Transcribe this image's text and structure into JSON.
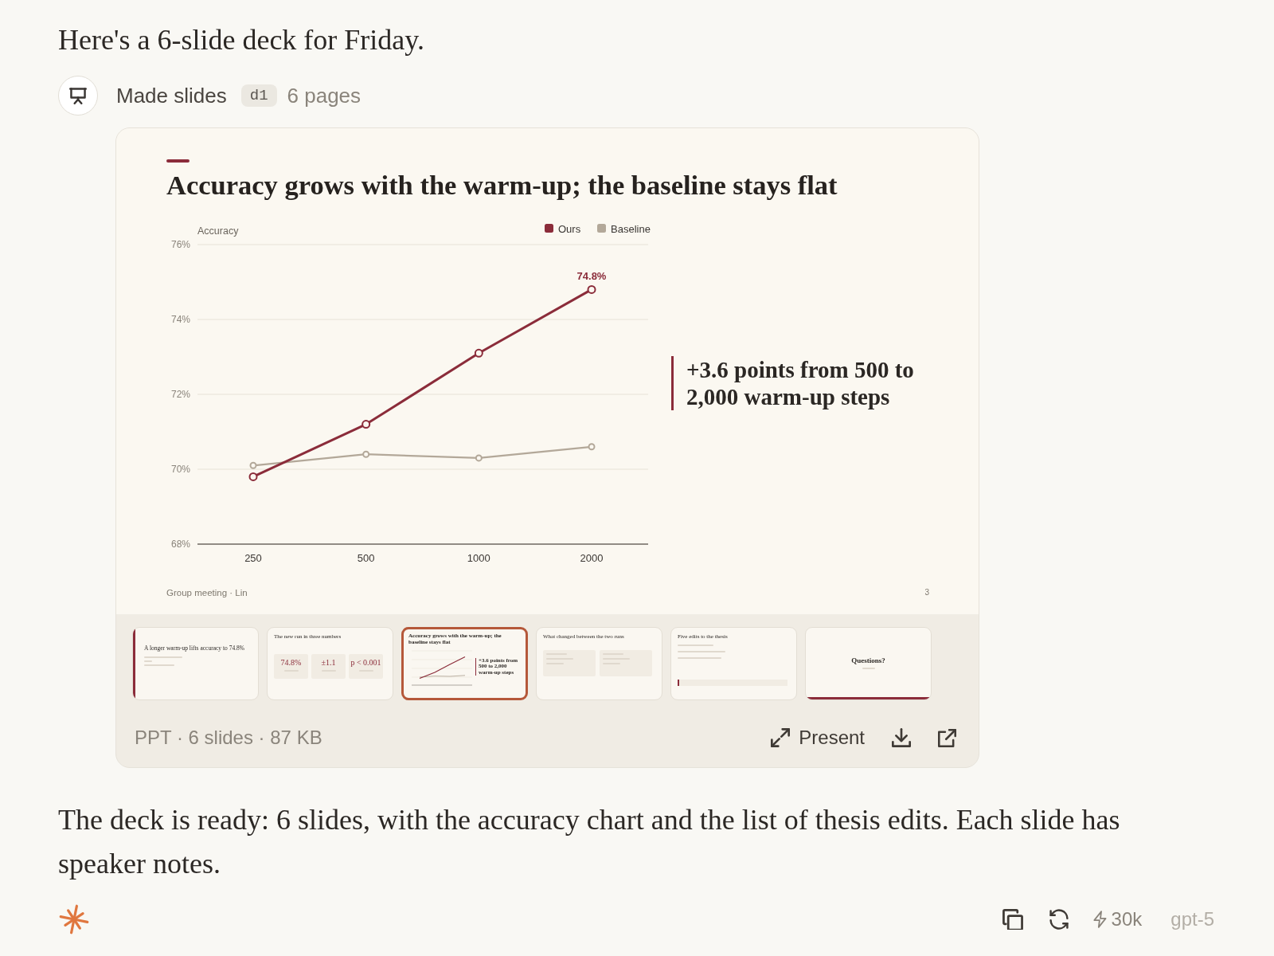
{
  "intro": "Here's a 6-slide deck for Friday.",
  "tool_call": {
    "label": "Made slides",
    "tag": "d1",
    "pages": "6 pages"
  },
  "deck": {
    "slide": {
      "title": "Accuracy grows with the warm-up; the baseline stays flat",
      "chart_data": {
        "type": "line",
        "ylabel": "Accuracy",
        "categories": [
          "250",
          "500",
          "1000",
          "2000"
        ],
        "series": [
          {
            "name": "Ours",
            "color": "#8b2c3a",
            "marker": "circle",
            "values": [
              69.8,
              71.2,
              73.1,
              74.8
            ]
          },
          {
            "name": "Baseline",
            "color": "#b3a899",
            "marker": "circle",
            "values": [
              70.1,
              70.4,
              70.3,
              70.6
            ]
          }
        ],
        "ylim": [
          68,
          76
        ],
        "yticks": [
          {
            "value": 76,
            "label": "76%"
          },
          {
            "value": 74,
            "label": "74%"
          },
          {
            "value": 72,
            "label": "72%"
          },
          {
            "value": 70,
            "label": "70%"
          },
          {
            "value": 68,
            "label": "68%"
          }
        ],
        "grid": true,
        "legend": "upper right",
        "annotations": [
          {
            "x": "2000",
            "y": 74.8,
            "text": "74.8%"
          }
        ]
      },
      "callout": "+3.6 points from 500 to 2,000 warm-up steps",
      "footer": "Group meeting · Lin",
      "page_number": "3"
    },
    "thumbnails": [
      {
        "kind": "title",
        "selected": false,
        "title": "A longer warm-up lifts accuracy to 74.8%"
      },
      {
        "kind": "stats",
        "selected": false,
        "title": "The new run in three numbers",
        "stats": [
          "74.8%",
          "±1.1",
          "p < 0.001"
        ]
      },
      {
        "kind": "chart",
        "selected": true,
        "title": "Accuracy grows with the warm-up; the baseline stays flat",
        "callout": "+3.6 points from 500 to 2,000 warm-up steps"
      },
      {
        "kind": "comparison",
        "selected": false,
        "title": "What changed between the two runs"
      },
      {
        "kind": "list",
        "selected": false,
        "title": "Five edits to the thesis"
      },
      {
        "kind": "closing",
        "selected": false,
        "title": "Questions?"
      }
    ],
    "file_info": "PPT · 6 slides · 87 KB",
    "actions": [
      {
        "kind": "present",
        "label": "Present"
      },
      {
        "kind": "download"
      },
      {
        "kind": "open_external"
      }
    ]
  },
  "reply": "The deck is ready: 6 slides, with the accuracy chart and the list of thesis edits. Each slide has speaker notes.",
  "message_actions": [
    {
      "kind": "copy"
    },
    {
      "kind": "regenerate"
    }
  ],
  "usage": {
    "tokens": "30k",
    "model": "gpt-5"
  }
}
